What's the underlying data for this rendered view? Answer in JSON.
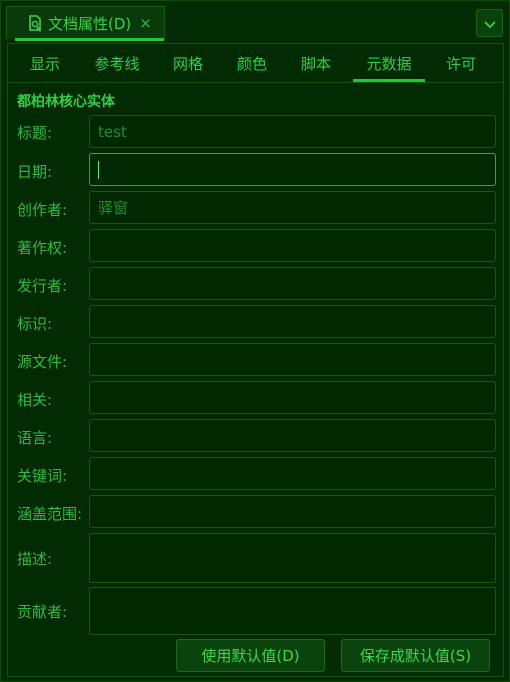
{
  "window": {
    "tab_title": "文档属性(D)",
    "close_glyph": "×",
    "menu_glyph": "chevron-down-icon"
  },
  "tabs": [
    "显示",
    "参考线",
    "网格",
    "颜色",
    "脚本",
    "元数据",
    "许可"
  ],
  "active_tab": "元数据",
  "section_title": "都柏林核心实体",
  "fields": [
    {
      "label": "标题:",
      "value": "test"
    },
    {
      "label": "日期:",
      "value": ""
    },
    {
      "label": "创作者:",
      "value": "驿窗"
    },
    {
      "label": "著作权:",
      "value": ""
    },
    {
      "label": "发行者:",
      "value": ""
    },
    {
      "label": "标识:",
      "value": ""
    },
    {
      "label": "源文件:",
      "value": ""
    },
    {
      "label": "相关:",
      "value": ""
    },
    {
      "label": "语言:",
      "value": ""
    },
    {
      "label": "关键词:",
      "value": ""
    },
    {
      "label": "涵盖范围:",
      "value": ""
    }
  ],
  "text_areas": [
    {
      "label": "描述:",
      "value": ""
    },
    {
      "label": "贡献者:",
      "value": ""
    }
  ],
  "buttons": {
    "use_default": "使用默认值(D)",
    "save_default": "保存成默认值(S)"
  },
  "colors": {
    "background": "#032b03",
    "accent": "#22c43a",
    "text": "#2fb845"
  }
}
